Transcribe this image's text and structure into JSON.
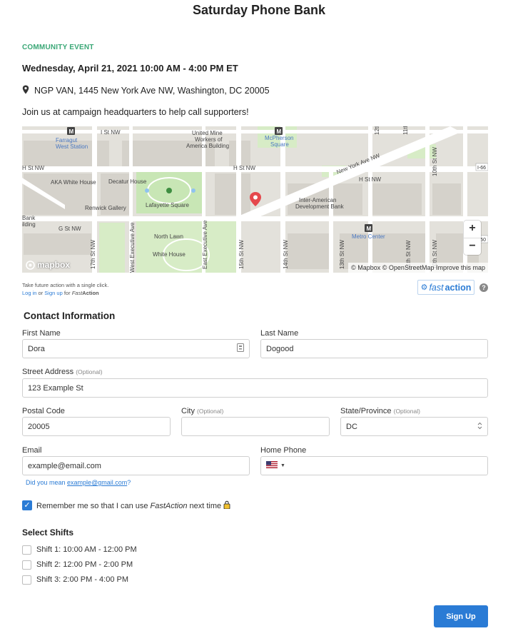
{
  "page": {
    "title": "Saturday Phone Bank"
  },
  "event": {
    "tag": "COMMUNITY EVENT",
    "date": "Wednesday, April 21, 2021 10:00 AM -  4:00 PM ET",
    "location": "NGP VAN, 1445 New York Ave NW, Washington, DC 20005",
    "description": "Join us at campaign headquarters to help call supporters!"
  },
  "map": {
    "labels": {
      "i_st": "I St NW",
      "farragut": "Farragut",
      "farragut2": "West Station",
      "united": "United Mine",
      "united2": "Workers of",
      "united3": "America Building",
      "mcpherson": "McPherson",
      "mcpherson2": "Square",
      "th12": "12th",
      "th11": "11th",
      "h_left": "H St NW",
      "h_mid": "H St NW",
      "h_right": "H St NW",
      "nyave": "New York Ave NW",
      "aka": "AKA White House",
      "decatur": "Decatur House",
      "lafayette": "Lafayette Square",
      "renwick": "Renwick Gallery",
      "interam": "Inter-American",
      "interam2": "Development Bank",
      "bank": "Bank",
      "bank2": "ilding",
      "g_st": "G St NW",
      "north_lawn": "North Lawn",
      "white_house": "White House",
      "east_exec": "East Executive Ave",
      "west_exec": "West Executive Ave",
      "th17": "17th St NW",
      "th15": "15th St NW",
      "th14": "14th St NW",
      "th13": "13th St NW",
      "th11b": "11th St NW",
      "th10": "10th St NW",
      "metro": "Metro Center",
      "i66": "I-66",
      "i50": "I-50"
    },
    "zoom_in": "+",
    "zoom_out": "−",
    "logo": "mapbox",
    "attribution": "© Mapbox © OpenStreetMap Improve this map"
  },
  "fastaction": {
    "note1": "Take future action with a single click.",
    "login": "Log in",
    "or": "or",
    "signup": "Sign up",
    "for": "for",
    "brand_a": "Fast",
    "brand_b": "Action",
    "badge_a": "fast",
    "badge_b": "action",
    "help": "?"
  },
  "contact": {
    "heading": "Contact Information",
    "first_name": {
      "label": "First Name",
      "value": "Dora"
    },
    "last_name": {
      "label": "Last Name",
      "value": "Dogood"
    },
    "street": {
      "label": "Street Address",
      "optional": "(Optional)",
      "value": "123 Example St"
    },
    "postal": {
      "label": "Postal Code",
      "value": "20005"
    },
    "city": {
      "label": "City",
      "optional": "(Optional)",
      "value": ""
    },
    "state": {
      "label": "State/Province",
      "optional": "(Optional)",
      "value": "DC"
    },
    "email": {
      "label": "Email",
      "value": "example@email.com"
    },
    "phone": {
      "label": "Home Phone",
      "value": ""
    },
    "hint_prefix": "Did you mean",
    "hint_link": "example@gmail.com",
    "hint_suffix": "?",
    "remember_a": "Remember me so that I can use",
    "remember_b": "FastAction",
    "remember_c": "next time"
  },
  "shifts": {
    "heading": "Select Shifts",
    "items": [
      "Shift 1: 10:00 AM - 12:00 PM",
      "Shift 2: 12:00 PM - 2:00 PM",
      "Shift 3: 2:00 PM - 4:00 PM"
    ]
  },
  "submit": "Sign Up",
  "colors": {
    "accent": "#2a7bd5",
    "tag": "#3aa776",
    "pin": "#e5484d"
  }
}
